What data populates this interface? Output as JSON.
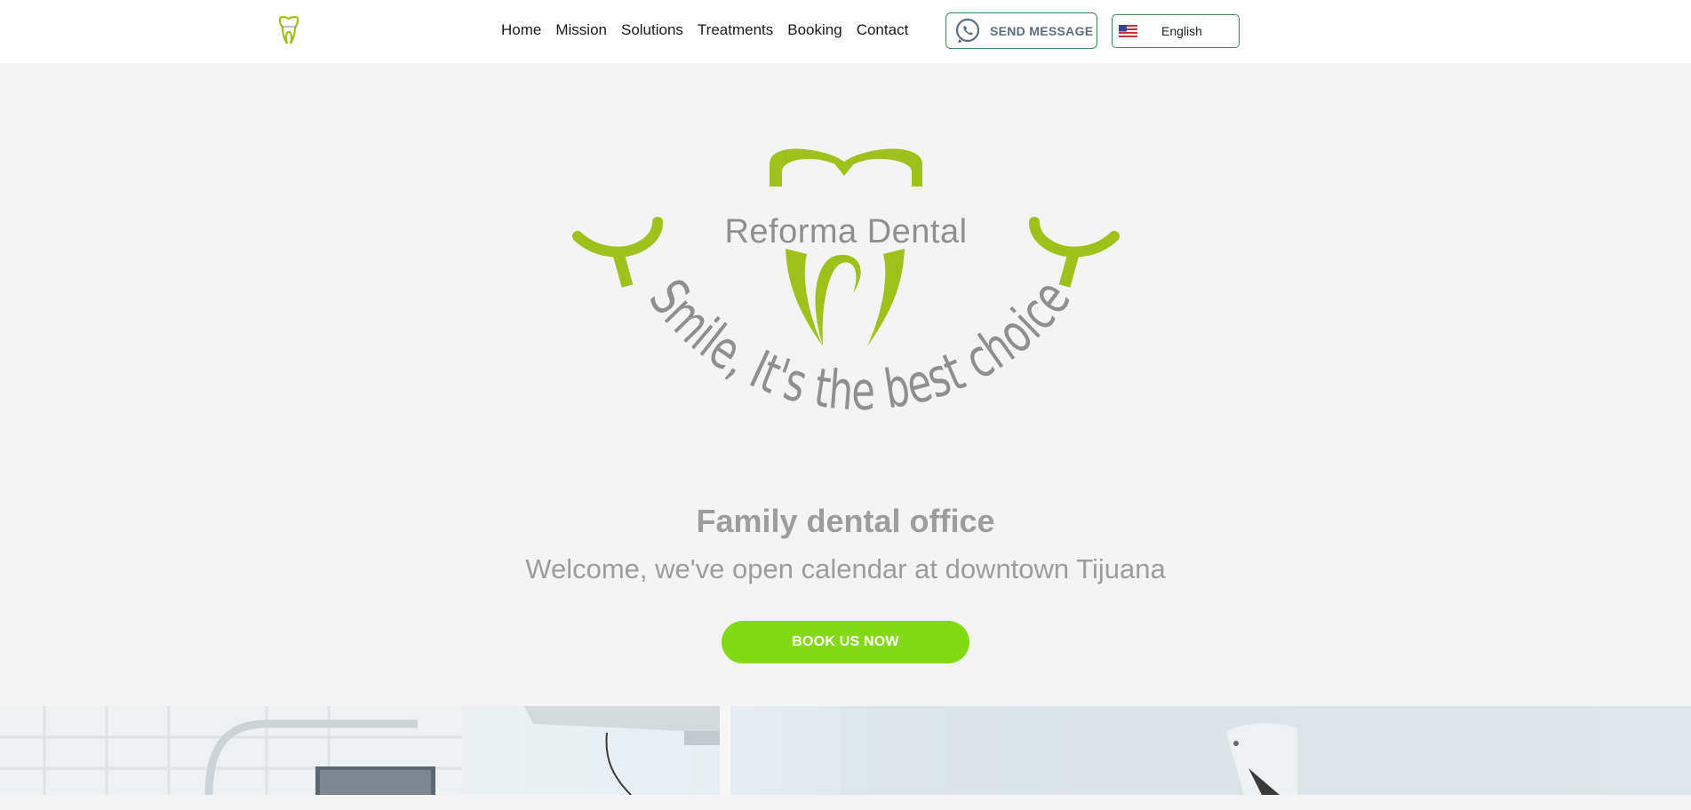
{
  "header": {
    "nav": [
      "Home",
      "Mission",
      "Solutions",
      "Treatments",
      "Booking",
      "Contact"
    ],
    "send_message_label": "SEND MESSAGE",
    "language_label": "English"
  },
  "logo": {
    "brand_name": "Reforma Dental",
    "slogan": "Smile, It's the best choice"
  },
  "hero": {
    "title": "Family dental office",
    "subtitle": "Welcome, we've open calendar at downtown Tijuana",
    "cta_label": "BOOK US NOW"
  },
  "colors": {
    "brand_green": "#9ec11c",
    "button_green": "#84d915",
    "text_gray": "#9d9d9d",
    "border_green": "#3e8a52"
  },
  "icons": {
    "whatsapp": "whatsapp-icon",
    "language_flag": "us-flag-icon"
  }
}
